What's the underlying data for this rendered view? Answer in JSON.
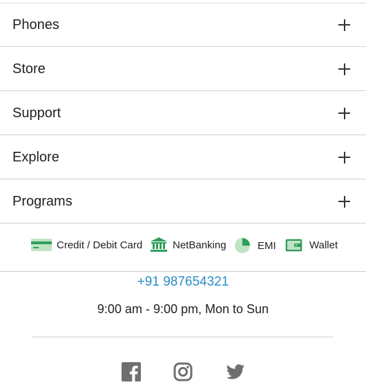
{
  "footer_menu": [
    {
      "label": "Phones"
    },
    {
      "label": "Store"
    },
    {
      "label": "Support"
    },
    {
      "label": "Explore"
    },
    {
      "label": "Programs"
    }
  ],
  "payments": [
    {
      "label": "Credit / Debit Card",
      "icon": "credit-card-icon"
    },
    {
      "label": "NetBanking",
      "icon": "bank-icon"
    },
    {
      "label": "EMI",
      "icon": "emi-pie-icon"
    },
    {
      "label": "Wallet",
      "icon": "wallet-icon"
    }
  ],
  "contact": {
    "phone": "+91 987654321",
    "hours": "9:00 am - 9:00 pm, Mon to Sun"
  },
  "social": [
    {
      "icon": "facebook-icon"
    },
    {
      "icon": "instagram-icon"
    },
    {
      "icon": "twitter-icon"
    }
  ],
  "colors": {
    "accent_green": "#2e9e5b",
    "light_green": "#bfe3c4",
    "link_blue": "#2a8fc4",
    "social_gray": "#6f6f6f"
  }
}
